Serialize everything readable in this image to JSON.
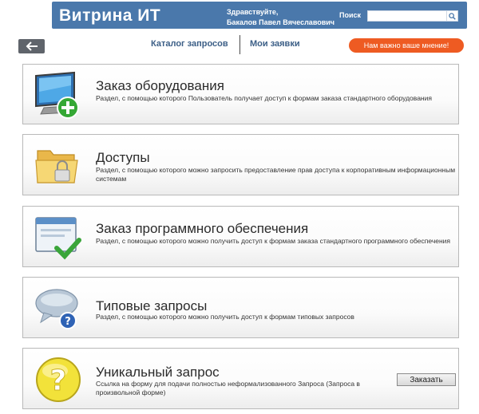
{
  "header": {
    "brand": "Витрина ИТ",
    "greeting_line1": "Здравствуйте,",
    "greeting_line2": "Бакалов Павел Вячеславович",
    "search_label": "Поиск",
    "search_value": ""
  },
  "nav": {
    "back_icon": "arrow-left-icon",
    "tab_catalog": "Каталог запросов",
    "tab_mine": "Мои заявки",
    "feedback_label": "Нам важно ваше мнение!"
  },
  "cards": [
    {
      "title": "Заказ оборудования",
      "description": "Раздел, с помощью которого Пользователь получает доступ к формам заказа стандартного оборудования",
      "icon": "monitor-plus-icon"
    },
    {
      "title": "Доступы",
      "description": "Раздел, с помощью которого можно запросить предоставление прав доступа к корпоративным информационным системам",
      "icon": "folder-lock-icon"
    },
    {
      "title": "Заказ программного обеспечения",
      "description": "Раздел, с помощью которого можно получить доступ к формам заказа стандартного программного обеспечения",
      "icon": "window-check-icon"
    },
    {
      "title": "Типовые запросы",
      "description": "Раздел, с помощью которого можно получить доступ к формам типовых запросов",
      "icon": "speech-bubble-question-icon"
    },
    {
      "title": "Уникальный запрос",
      "description": "Ссылка на форму для подачи полностью неформализованного Запроса (Запроса в произвольной форме)",
      "icon": "question-mark-icon",
      "button_label": "Заказать"
    }
  ],
  "colors": {
    "header_bg": "#4a78ab",
    "accent_orange": "#ee5b22",
    "nav_link": "#3b5e86"
  }
}
